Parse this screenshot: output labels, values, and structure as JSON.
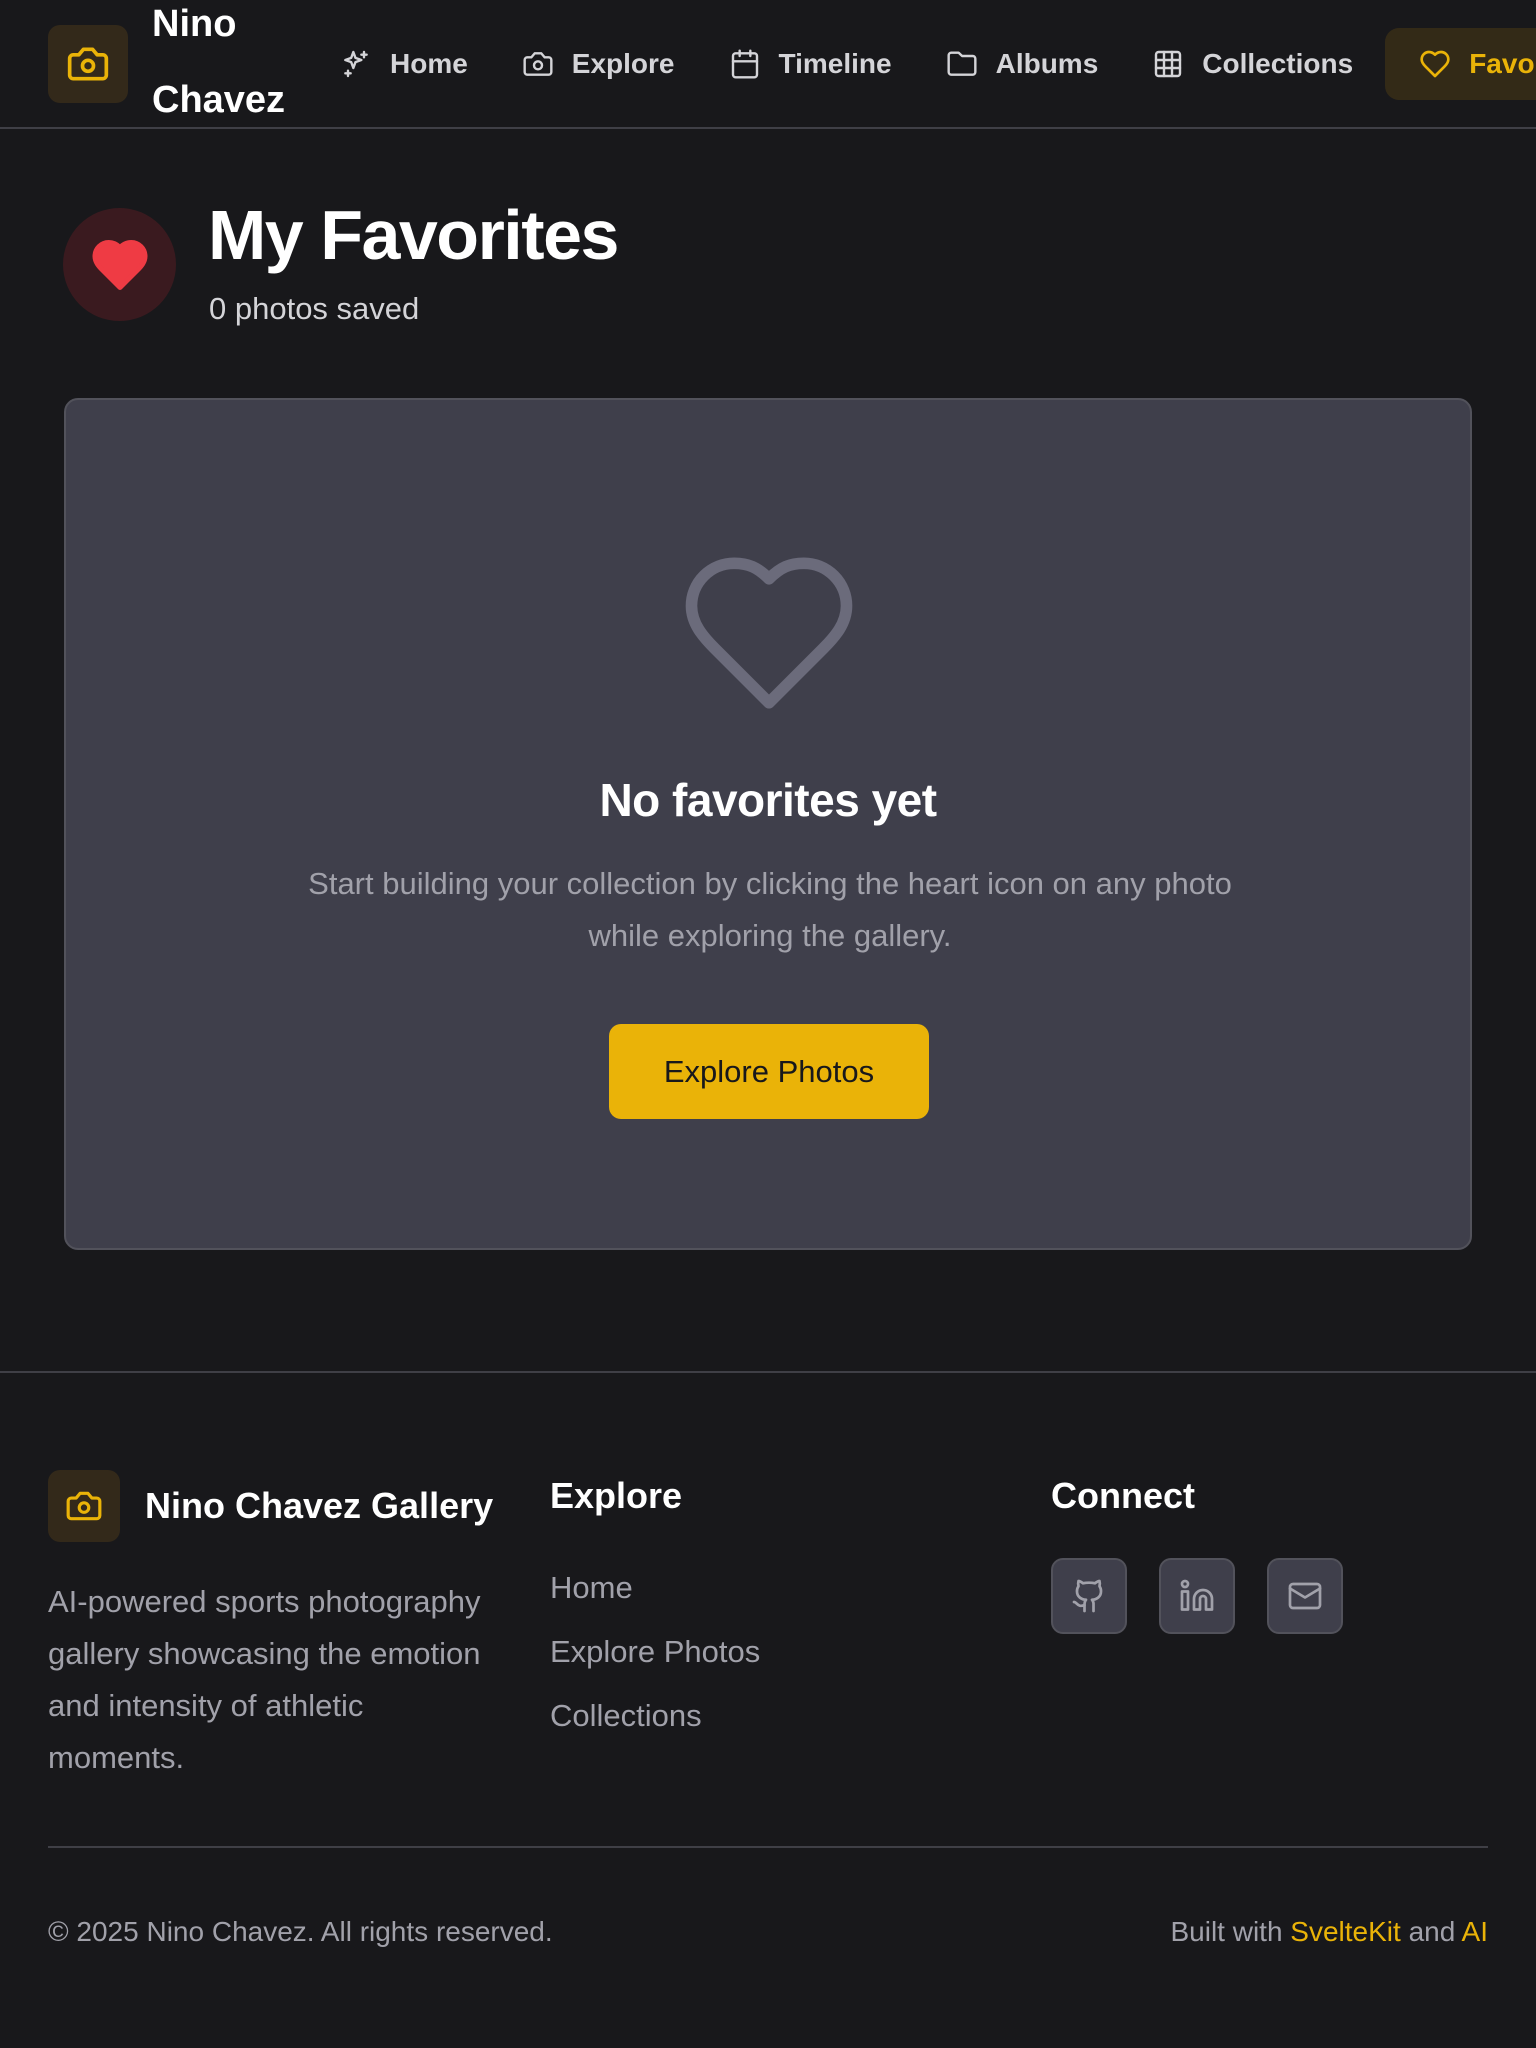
{
  "brand": {
    "name": "Nino Chavez Gallery"
  },
  "nav": {
    "items": [
      {
        "label": "Home",
        "icon": "sparkles-icon"
      },
      {
        "label": "Explore",
        "icon": "camera-icon"
      },
      {
        "label": "Timeline",
        "icon": "calendar-icon"
      },
      {
        "label": "Albums",
        "icon": "folder-icon"
      },
      {
        "label": "Collections",
        "icon": "grid-icon"
      },
      {
        "label": "Favorites",
        "icon": "heart-icon",
        "active": true
      }
    ]
  },
  "page": {
    "title": "My Favorites",
    "subtitle": "0 photos saved"
  },
  "empty_state": {
    "title": "No favorites yet",
    "text": "Start building your collection by clicking the heart icon on any photo while exploring the gallery.",
    "button_label": "Explore Photos"
  },
  "footer": {
    "brand_name": "Nino Chavez Gallery",
    "description": "AI-powered sports photography gallery showcasing the emotion and intensity of athletic moments.",
    "explore_heading": "Explore",
    "explore_links": [
      "Home",
      "Explore Photos",
      "Collections"
    ],
    "connect_heading": "Connect",
    "social": [
      "github-icon",
      "linkedin-icon",
      "mail-icon"
    ],
    "copyright": "© 2025 Nino Chavez. All rights reserved.",
    "built_prefix": "Built with",
    "built_tech": "SvelteKit",
    "built_and": "and",
    "built_ai": "AI"
  },
  "colors": {
    "background": "#18181b",
    "accent": "#eab308",
    "card": "#3f3f4b",
    "favorite_red": "#ef4444"
  }
}
